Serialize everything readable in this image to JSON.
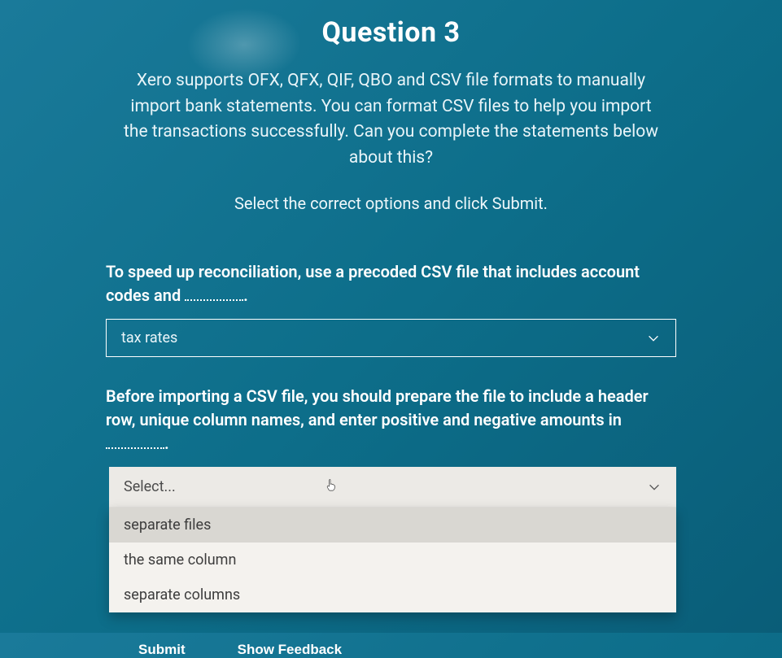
{
  "title": "Question 3",
  "description": "Xero supports OFX, QFX, QIF, QBO and CSV file formats to manually import bank statements. You can format CSV files to help you import the transactions successfully. Can you complete the statements below about this?",
  "instruction": "Select the correct options and click Submit.",
  "prompt1_a": "To speed up reconciliation, use a precoded CSV file that includes account codes and ",
  "prompt1_b": ".",
  "select1_value": "tax rates",
  "prompt2_a": "Before importing a CSV file, you should prepare the file to include a header row, unique column names, and enter positive and negative amounts in ",
  "prompt2_b": ".",
  "select2_placeholder": "Select...",
  "select2_options": {
    "0": "separate files",
    "1": "the same column",
    "2": "separate columns"
  },
  "buttons": {
    "submit": "Submit",
    "feedback": "Show Feedback"
  }
}
